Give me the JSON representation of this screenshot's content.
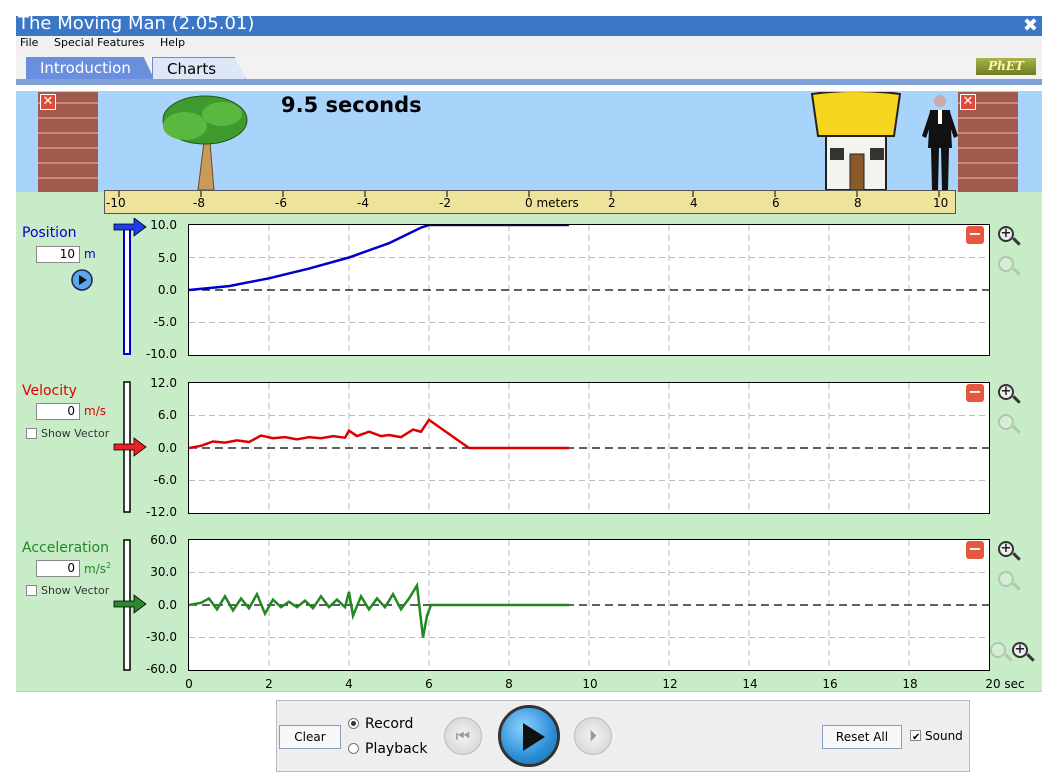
{
  "window": {
    "title": "The Moving Man (2.05.01)",
    "close_glyph": "✖"
  },
  "menu": {
    "file": "File",
    "special": "Special Features",
    "help": "Help"
  },
  "tabs": {
    "introduction": "Introduction",
    "charts": "Charts"
  },
  "logo_text": "PhET",
  "scene": {
    "time_readout": "9.5 seconds",
    "ruler_labels": [
      "-10",
      "-8",
      "-6",
      "-4",
      "-2",
      "0 meters",
      "2",
      "4",
      "6",
      "8",
      "10"
    ],
    "wall_close_glyph": "✕"
  },
  "charts": {
    "position": {
      "label": "Position",
      "value": "10",
      "unit": "m",
      "color": "#0000cc",
      "yticks": [
        "10.0",
        "5.0",
        "0.0",
        "-5.0",
        "-10.0"
      ]
    },
    "velocity": {
      "label": "Velocity",
      "value": "0",
      "unit": "m/s",
      "color": "#dd0000",
      "show_vector": "Show Vector",
      "yticks": [
        "12.0",
        "6.0",
        "0.0",
        "-6.0",
        "-12.0"
      ]
    },
    "acceleration": {
      "label": "Acceleration",
      "value": "0",
      "unit": "m/s",
      "unit_sup": "2",
      "color": "#228822",
      "show_vector": "Show Vector",
      "yticks": [
        "60.0",
        "30.0",
        "0.0",
        "-30.0",
        "-60.0"
      ]
    },
    "xticks": [
      "0",
      "2",
      "4",
      "6",
      "8",
      "10",
      "12",
      "14",
      "16",
      "18",
      "20 sec"
    ],
    "minus_glyph": "−",
    "zoom_glyph": "+"
  },
  "chart_data": [
    {
      "type": "line",
      "ylabel": "Position",
      "ylim": [
        -10,
        10
      ],
      "xlim": [
        0,
        20
      ],
      "series": [
        {
          "name": "Position",
          "x": [
            0,
            1,
            2,
            3,
            4,
            5,
            5.8,
            6,
            7,
            8,
            9.5
          ],
          "values": [
            0,
            0.6,
            1.8,
            3.3,
            5,
            7.2,
            9.6,
            10,
            10,
            10,
            10
          ]
        }
      ]
    },
    {
      "type": "line",
      "ylabel": "Velocity",
      "ylim": [
        -12,
        12
      ],
      "xlim": [
        0,
        20
      ],
      "series": [
        {
          "name": "Velocity",
          "x": [
            0,
            0.3,
            0.6,
            0.9,
            1.2,
            1.5,
            1.8,
            2.1,
            2.4,
            2.7,
            3,
            3.3,
            3.6,
            3.9,
            4.0,
            4.2,
            4.5,
            4.8,
            5.0,
            5.3,
            5.6,
            5.8,
            6.0,
            7,
            8,
            9.5
          ],
          "values": [
            0,
            0.4,
            1.2,
            1.0,
            1.4,
            1.1,
            2.3,
            1.8,
            2.0,
            1.6,
            2.0,
            1.8,
            2.2,
            1.9,
            3.2,
            2.2,
            3.0,
            2.2,
            2.4,
            2.0,
            3.4,
            3.0,
            5.2,
            0,
            0,
            0
          ]
        }
      ]
    },
    {
      "type": "line",
      "ylabel": "Acceleration",
      "ylim": [
        -60,
        60
      ],
      "xlim": [
        0,
        20
      ],
      "series": [
        {
          "name": "Acceleration",
          "x": [
            0,
            0.3,
            0.5,
            0.7,
            0.9,
            1.1,
            1.3,
            1.5,
            1.7,
            1.9,
            2.1,
            2.3,
            2.5,
            2.7,
            2.9,
            3.1,
            3.3,
            3.5,
            3.7,
            3.9,
            4.0,
            4.1,
            4.3,
            4.5,
            4.7,
            4.9,
            5.1,
            5.3,
            5.5,
            5.7,
            5.85,
            5.95,
            6.05,
            7,
            8,
            9.5
          ],
          "values": [
            0,
            2,
            6,
            -4,
            8,
            -5,
            6,
            -3,
            10,
            -8,
            5,
            -2,
            3,
            -2,
            4,
            -3,
            8,
            -2,
            5,
            -2,
            12,
            -10,
            8,
            -4,
            6,
            -2,
            10,
            -4,
            6,
            18,
            -30,
            -10,
            0,
            0,
            0,
            0
          ]
        }
      ]
    }
  ],
  "controls": {
    "clear": "Clear",
    "record": "Record",
    "playback": "Playback",
    "reset_all": "Reset All",
    "sound": "Sound",
    "rewind_glyph": "⏮",
    "step_glyph": "⏵"
  }
}
